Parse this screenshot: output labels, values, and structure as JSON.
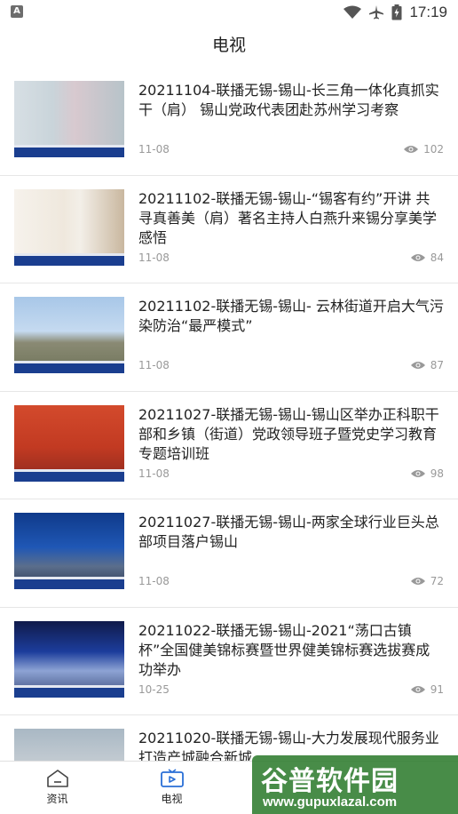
{
  "status_bar": {
    "time": "17:19"
  },
  "header": {
    "title": "电视"
  },
  "videos": [
    {
      "title": "20211104-联播无锡-锡山-长三角一体化真抓实干（肩） 锡山党政代表团赴苏州学习考察",
      "date": "11-08",
      "views": "102"
    },
    {
      "title": " 20211102-联播无锡-锡山-“锡客有约”开讲 共寻真善美（肩）著名主持人白燕升来锡分享美学感悟",
      "date": "11-08",
      "views": "84"
    },
    {
      "title": "20211102-联播无锡-锡山- 云林街道开启大气污染防治“最严模式”",
      "date": "11-08",
      "views": "87"
    },
    {
      "title": "20211027-联播无锡-锡山-锡山区举办正科职干部和乡镇（街道）党政领导班子暨党史学习教育专题培训班",
      "date": "11-08",
      "views": "98"
    },
    {
      "title": "20211027-联播无锡-锡山-两家全球行业巨头总部项目落户锡山",
      "date": "11-08",
      "views": "72"
    },
    {
      "title": "20211022-联播无锡-锡山-2021“荡口古镇杯”全国健美锦标赛暨世界健美锦标赛选拔赛成功举办",
      "date": "10-25",
      "views": "91"
    },
    {
      "title": "20211020-联播无锡-锡山-大力发展现代服务业 打造产城融合新城",
      "date": "",
      "views": ""
    }
  ],
  "tabs": [
    {
      "label": "资讯",
      "icon": "home-icon"
    },
    {
      "label": "电视",
      "icon": "tv-icon",
      "active": true
    }
  ],
  "watermark": {
    "title": "谷普软件园",
    "url": "www.gupuxlazal.com"
  },
  "colors": {
    "tab_active": "#2a6fd6",
    "tab_inactive": "#444444"
  }
}
